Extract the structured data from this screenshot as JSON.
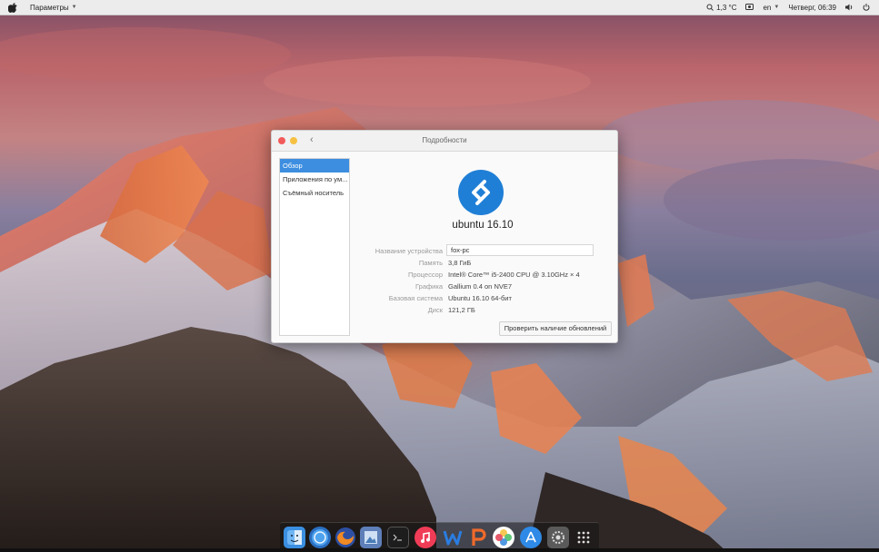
{
  "topbar": {
    "menu_label": "Параметры",
    "temperature": "1,3 °C",
    "keyboard_layout": "en",
    "datetime": "Четверг, 06:39"
  },
  "window": {
    "title": "Подробности",
    "sidebar_items": [
      {
        "label": "Обзор",
        "active": true
      },
      {
        "label": "Приложения по ум...",
        "active": false
      },
      {
        "label": "Съёмный носитель",
        "active": false
      }
    ],
    "distro_name": "ubuntu 16.10",
    "details": {
      "device_name_label": "Название устройства",
      "device_name_value": "fox-pc",
      "memory_label": "Память",
      "memory_value": "3,8 ГиБ",
      "processor_label": "Процессор",
      "processor_value": "Intel® Core™ i5-2400 CPU @ 3.10GHz × 4",
      "graphics_label": "Графика",
      "graphics_value": "Gallium 0.4 on NVE7",
      "os_type_label": "Базовая система",
      "os_type_value": "Ubuntu 16.10 64-бит",
      "disk_label": "Диск",
      "disk_value": "121,2 ГБ"
    },
    "update_button": "Проверить наличие обновлений"
  },
  "dock": {
    "icons": [
      "finder-icon",
      "browser-icon",
      "firefox-icon",
      "preview-icon",
      "terminal-icon",
      "music-icon",
      "writer-icon",
      "presentation-icon",
      "photos-icon",
      "app-store-icon",
      "settings-icon",
      "app-grid-icon"
    ]
  },
  "colors": {
    "accent": "#3d8ee0",
    "logo_blue": "#1f7fd6",
    "close": "#f25b5b",
    "minimize": "#f6c142"
  }
}
